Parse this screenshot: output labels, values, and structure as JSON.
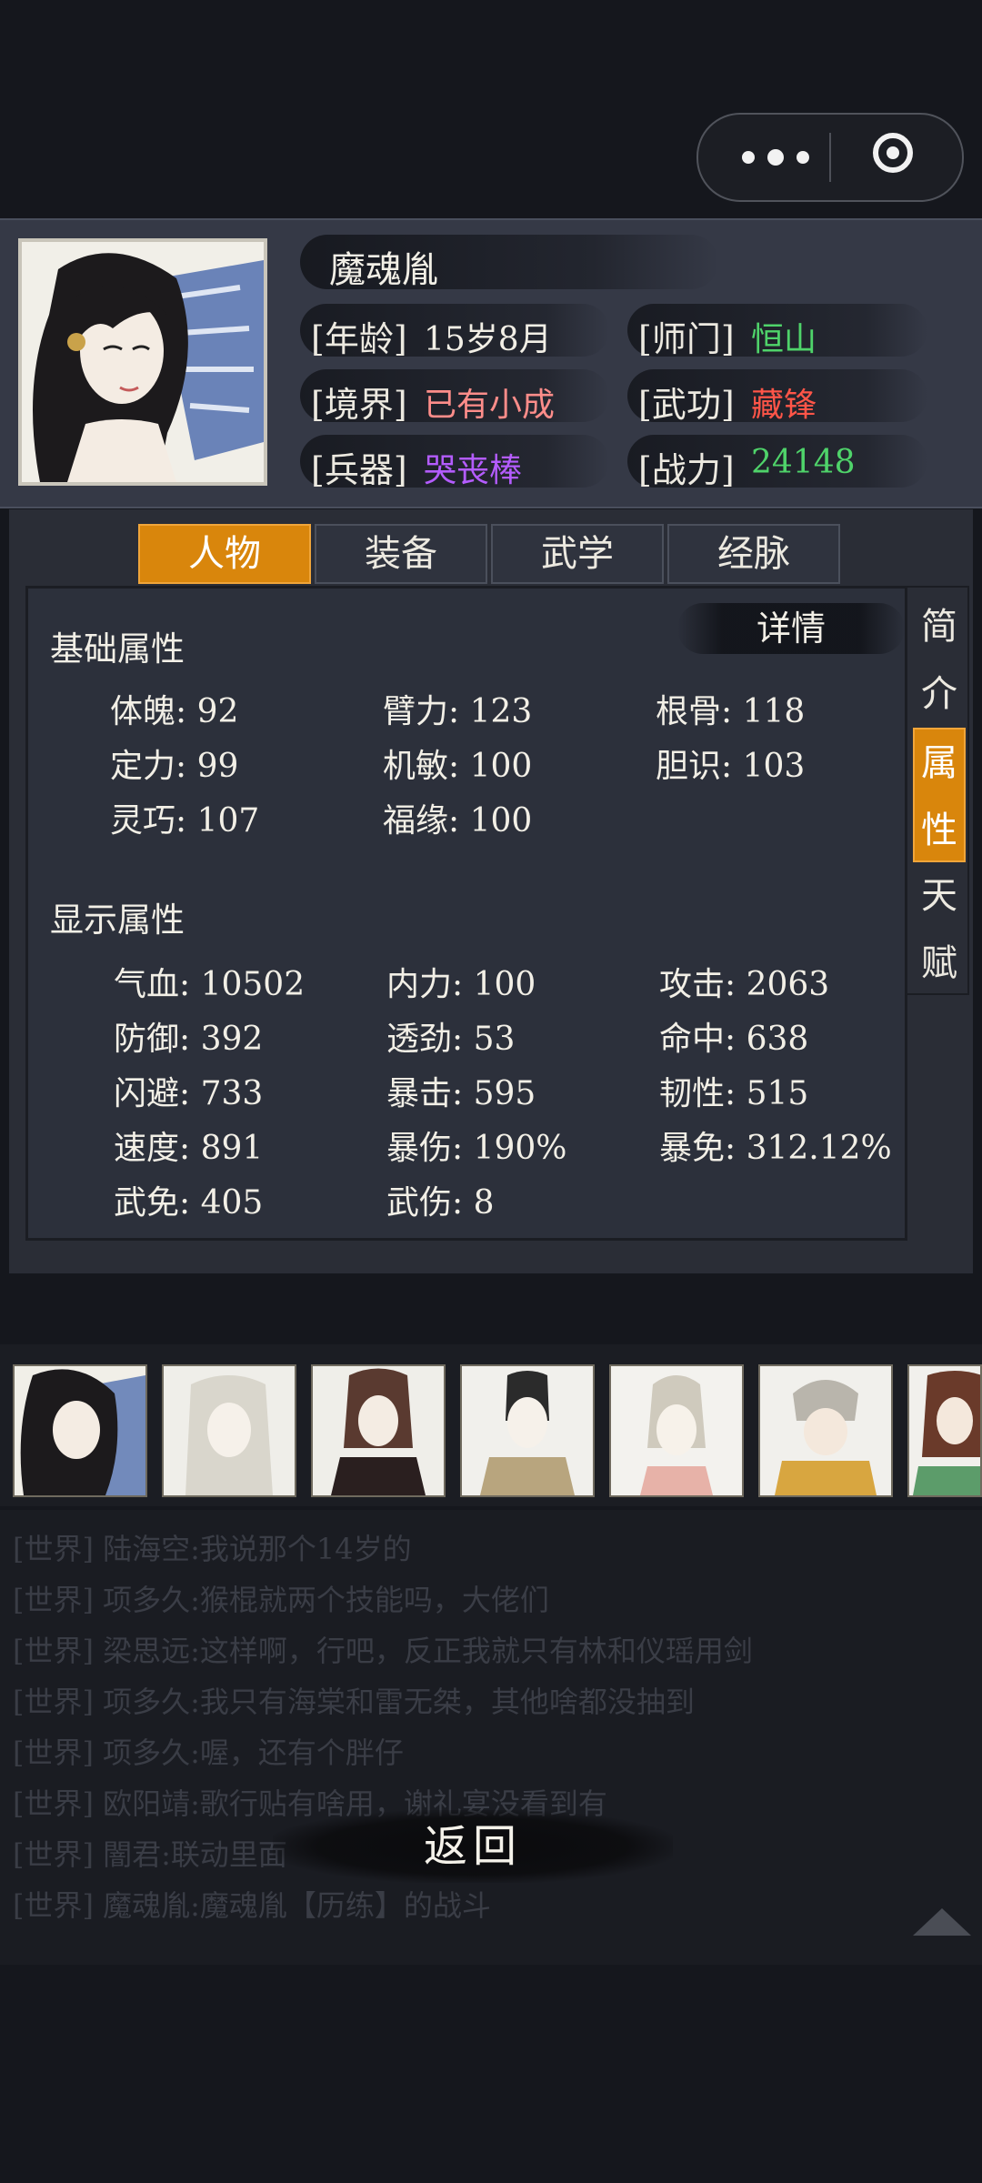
{
  "character": {
    "name": "魔魂胤",
    "age_label": "[年龄]",
    "age": "15岁8月",
    "sect_label": "[师门]",
    "sect": "恒山",
    "realm_label": "[境界]",
    "realm": "已有小成",
    "martial_label": "[武功]",
    "martial": "藏锋",
    "weapon_label": "[兵器]",
    "weapon": "哭丧棒",
    "power_label": "[战力]",
    "power": "24148"
  },
  "colors": {
    "green": "#4fd36a",
    "red": "#ff5548",
    "pink": "#ff8d8a",
    "purple": "#b45cff",
    "accent": "#d9860c"
  },
  "tabs": [
    "人物",
    "装备",
    "武学",
    "经脉"
  ],
  "side_tabs": [
    "简介",
    "属性",
    "天赋"
  ],
  "detail_label": "详情",
  "basic": {
    "title": "基础属性",
    "items": [
      {
        "label": "体魄",
        "value": "92"
      },
      {
        "label": "臂力",
        "value": "123"
      },
      {
        "label": "根骨",
        "value": "118"
      },
      {
        "label": "定力",
        "value": "99"
      },
      {
        "label": "机敏",
        "value": "100"
      },
      {
        "label": "胆识",
        "value": "103"
      },
      {
        "label": "灵巧",
        "value": "107"
      },
      {
        "label": "福缘",
        "value": "100"
      }
    ]
  },
  "display": {
    "title": "显示属性",
    "items": [
      {
        "label": "气血",
        "value": "10502"
      },
      {
        "label": "内力",
        "value": "100"
      },
      {
        "label": "攻击",
        "value": "2063"
      },
      {
        "label": "防御",
        "value": "392"
      },
      {
        "label": "透劲",
        "value": "53"
      },
      {
        "label": "命中",
        "value": "638"
      },
      {
        "label": "闪避",
        "value": "733"
      },
      {
        "label": "暴击",
        "value": "595"
      },
      {
        "label": "韧性",
        "value": "515"
      },
      {
        "label": "速度",
        "value": "891"
      },
      {
        "label": "暴伤",
        "value": "190%"
      },
      {
        "label": "暴免",
        "value": "312.12%"
      },
      {
        "label": "武免",
        "value": "405"
      },
      {
        "label": "武伤",
        "value": "8"
      }
    ]
  },
  "chat": [
    "[世界] 陆海空:我说那个14岁的",
    "[世界] 项多久:猴棍就两个技能吗，大佬们",
    "[世界] 梁思远:这样啊，行吧，反正我就只有林和仪瑶用剑",
    "[世界] 项多久:我只有海棠和雷无桀，其他啥都没抽到",
    "[世界] 项多久:喔，还有个胖仔",
    "[世界] 欧阳靖:歌行贴有啥用，谢礼宴没看到有",
    "[世界] 闇君:联动里面",
    "[世界] 魔魂胤:魔魂胤【历练】的战斗"
  ],
  "back_label": "返回"
}
